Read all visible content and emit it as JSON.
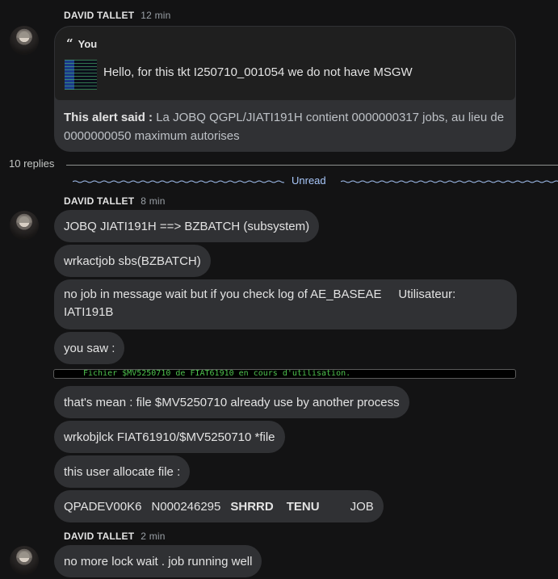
{
  "thread_top": {
    "sender": "DAVID TALLET",
    "time": "12 min",
    "quote_label": "You",
    "quote_text": "Hello, for this tkt I250710_001054 we do not have MSGW",
    "alert_prefix": "This alert said :",
    "alert_body": "La JOBQ QGPL/JIATI191H contient 0000000317 jobs, au lieu de 0000000050 maximum autorises"
  },
  "replies_label": "10 replies",
  "unread_label": "Unread",
  "group1": {
    "sender": "DAVID TALLET",
    "time": "8 min",
    "messages": [
      "JOBQ JIATI191H ==> BZBATCH (subsystem)",
      "wrkactjob sbs(BZBATCH)",
      "no job in message wait but if you check log of AE_BASEAE     Utilisateur: IATI191B",
      "you saw :",
      "that's mean : file $MV5250710 already use by another process",
      "wrkobjlck FIAT61910/$MV5250710 *file",
      "this user allocate file :"
    ],
    "code_line": "Fichier $MV5250710 de FIAT61910 en cours d'utilisation.",
    "lock_row": {
      "c1": "QPADEV00K6",
      "c2": "N000246295",
      "c3": "SHRRD",
      "c4": "TENU",
      "c5": "JOB"
    }
  },
  "group2": {
    "sender": "DAVID TALLET",
    "time": "2 min",
    "messages": [
      "no more lock wait . job running well"
    ]
  },
  "colors": {
    "background": "#131314",
    "bubble": "#303134",
    "unread_accent": "#a8c7fa",
    "code_green": "#4ec24e"
  }
}
